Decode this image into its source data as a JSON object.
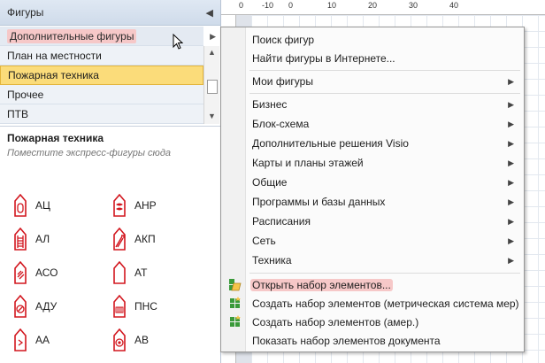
{
  "pane": {
    "title": "Фигуры",
    "collapse_icon": "chevron-left-icon"
  },
  "stencils": {
    "items": [
      {
        "label": "Дополнительные фигуры",
        "state": "hover",
        "has_submenu": true
      },
      {
        "label": "План на местности",
        "state": "normal"
      },
      {
        "label": "Пожарная техника",
        "state": "selected"
      },
      {
        "label": "Прочее",
        "state": "normal"
      },
      {
        "label": "ПТВ",
        "state": "normal"
      }
    ]
  },
  "stencil_info": {
    "title": "Пожарная техника",
    "hint": "Поместите экспресс-фигуры сюда"
  },
  "shapes": [
    {
      "label": "АЦ",
      "icon": "fire-truck-tanker-icon"
    },
    {
      "label": "АНР",
      "icon": "fire-truck-pump-hose-icon"
    },
    {
      "label": "АЛ",
      "icon": "fire-ladder-truck-icon"
    },
    {
      "label": "АКП",
      "icon": "fire-aerial-lift-icon"
    },
    {
      "label": "АСО",
      "icon": "lighting-vehicle-icon"
    },
    {
      "label": "АТ",
      "icon": "technical-service-vehicle-icon"
    },
    {
      "label": "АДУ",
      "icon": "smoke-removal-vehicle-icon"
    },
    {
      "label": "ПНС",
      "icon": "pump-station-icon"
    },
    {
      "label": "АА",
      "icon": "airfield-vehicle-icon"
    },
    {
      "label": "АВ",
      "icon": "water-foam-vehicle-icon"
    }
  ],
  "ruler": {
    "top_labels": [
      "0",
      "-10",
      "0",
      "10",
      "20",
      "30",
      "40"
    ]
  },
  "menu": {
    "items": [
      {
        "label": "Поиск фигур",
        "submenu": false
      },
      {
        "label": "Найти фигуры в Интернете...",
        "submenu": false
      },
      {
        "label": "Мои фигуры",
        "submenu": true
      },
      {
        "label": "Бизнес",
        "submenu": true
      },
      {
        "label": "Блок-схема",
        "submenu": true
      },
      {
        "label": "Дополнительные решения Visio",
        "submenu": true
      },
      {
        "label": "Карты и планы этажей",
        "submenu": true
      },
      {
        "label": "Общие",
        "submenu": true
      },
      {
        "label": "Программы и базы данных",
        "submenu": true
      },
      {
        "label": "Расписания",
        "submenu": true
      },
      {
        "label": "Сеть",
        "submenu": true
      },
      {
        "label": "Техника",
        "submenu": true
      },
      {
        "label": "Открыть набор элементов...",
        "submenu": false,
        "icon": "open-stencil-icon",
        "highlighted": true
      },
      {
        "label": "Создать набор элементов (метрическая система мер)",
        "submenu": false,
        "icon": "new-stencil-metric-icon"
      },
      {
        "label": "Создать набор элементов (амер.)",
        "submenu": false,
        "icon": "new-stencil-us-icon"
      },
      {
        "label": "Показать набор элементов документа",
        "submenu": false
      }
    ]
  },
  "colors": {
    "hover_highlight": "#f6c8c8",
    "selected_row": "#fbdc7a",
    "shape_red": "#d2161e"
  }
}
